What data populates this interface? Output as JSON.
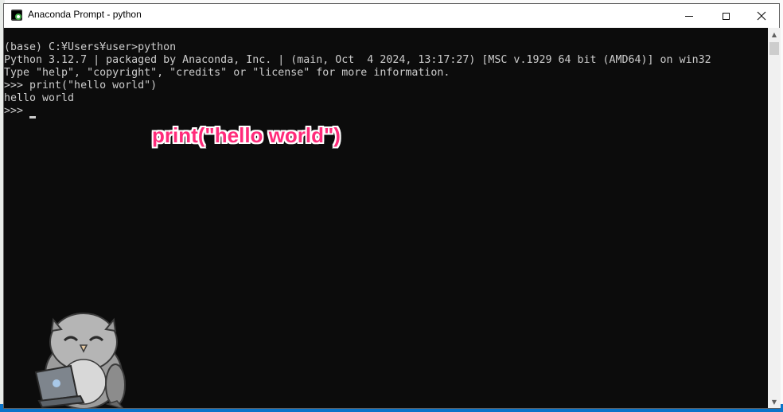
{
  "window": {
    "title": "Anaconda Prompt - python",
    "controls": {
      "minimize_icon": "minimize-icon",
      "maximize_icon": "maximize-icon",
      "close_icon": "close-icon"
    }
  },
  "console": {
    "lines": [
      "(base) C:¥Users¥user>python",
      "Python 3.12.7 | packaged by Anaconda, Inc. | (main, Oct  4 2024, 13:17:27) [MSC v.1929 64 bit (AMD64)] on win32",
      "Type \"help\", \"copyright\", \"credits\" or \"license\" for more information.",
      ">>> print(\"hello world\")",
      "hello world",
      ">>> "
    ],
    "text_color": "#cccccc",
    "background": "#0c0c0c"
  },
  "annotation": {
    "text": "print(\"hello world\")",
    "color": "#ff2b7a"
  },
  "watermark": {
    "text": ""
  }
}
